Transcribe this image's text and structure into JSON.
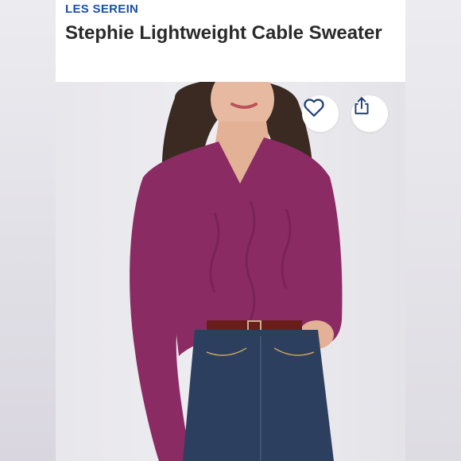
{
  "product": {
    "brand": "LES SEREIN",
    "title": "Stephie Lightweight Cable Sweater",
    "image_alt": "Woman wearing a magenta v-neck cable sweater and dark jeans"
  },
  "actions": {
    "favorite_icon": "heart-outline-icon",
    "share_icon": "share-upload-icon"
  },
  "colors": {
    "brand_text": "#1c4fa8",
    "title_text": "#2a2a2a",
    "sweater": "#8b2b63",
    "jeans": "#2c3f5f"
  }
}
